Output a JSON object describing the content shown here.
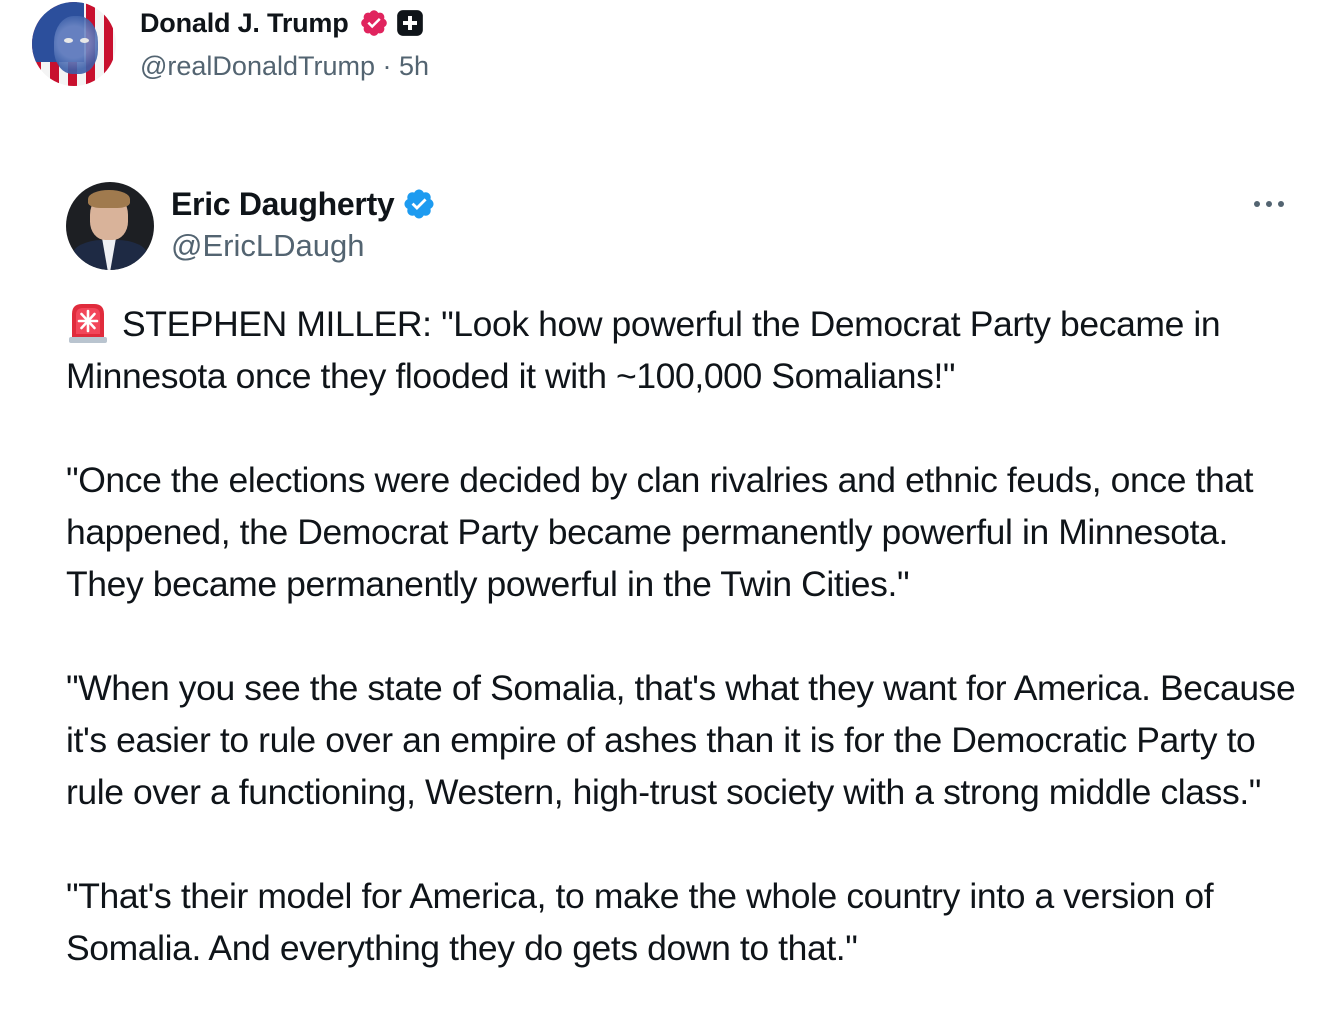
{
  "author": {
    "name": "Donald J. Trump",
    "handle": "@realDonaldTrump",
    "separator": "·",
    "time": "5h",
    "badges": [
      "verified-pink-badge-icon",
      "plus-square-badge-icon"
    ],
    "badge_color": "#e0245e"
  },
  "quoted_post": {
    "name": "Eric Daugherty",
    "handle": "@EricLDaugh",
    "verified_badge": "verified-blue-badge-icon",
    "verified_color": "#1d9bf0",
    "more_icon": "more-options-icon",
    "lead_icon": "police-siren-icon",
    "paragraphs": [
      "STEPHEN MILLER: \"Look how powerful the Democrat Party became in Minnesota once they flooded it with ~100,000 Somalians!\"",
      "\"Once the elections were decided by clan rivalries and ethnic feuds, once that happened, the Democrat Party became permanently powerful in Minnesota. They became permanently powerful in the Twin Cities.\"",
      "\"When you see the state of Somalia, that's what they want for America. Because it's easier to rule over an empire of ashes than it is for the Democratic Party to rule over a functioning, Western, high-trust society with a strong middle class.\"",
      "\"That's their model for America, to make the whole country into a version of Somalia. And everything they do gets down to that.\""
    ]
  },
  "colors": {
    "text_primary": "#0f1419",
    "text_secondary": "#536471"
  }
}
